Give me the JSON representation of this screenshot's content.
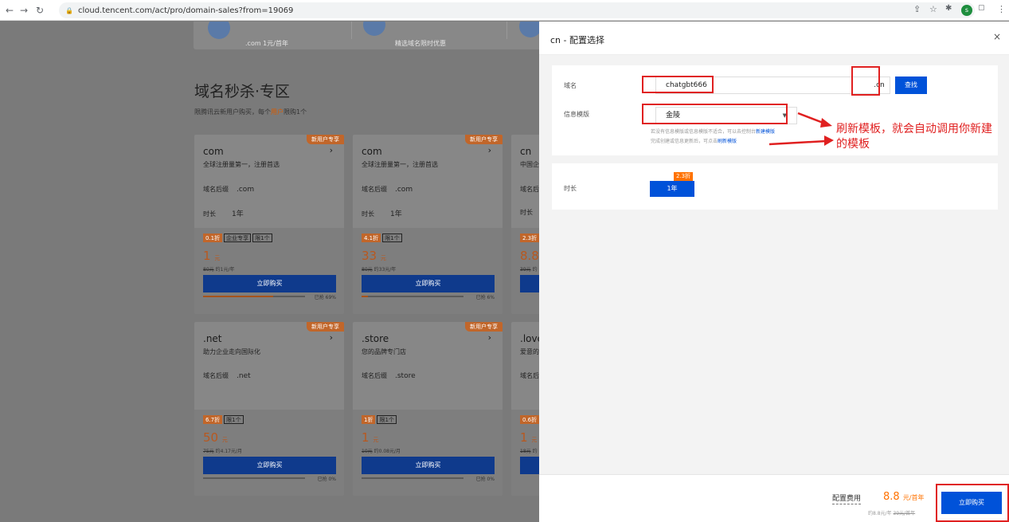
{
  "browser": {
    "url": "cloud.tencent.com/act/pro/domain-sales?from=19069",
    "avatar": "s"
  },
  "top_strip": [
    {
      "sub": ".com 1元/首年"
    },
    {
      "sub": "精选域名限时优惠"
    }
  ],
  "page": {
    "title": "域名秒杀·专区",
    "subtitle_pre": "限腾讯云新用户购买，每个",
    "subtitle_hl": "用户",
    "subtitle_post": "限购1个"
  },
  "cards": [
    {
      "tag": "新用户专享",
      "name": "com",
      "desc": "全球注册量第一，注册首选",
      "suffix_label": "域名后缀",
      "suffix": ".com",
      "dur_label": "时长",
      "dur": "1年",
      "badges": [
        "0.1折",
        "企业专享",
        "限1个"
      ],
      "price": "1",
      "unit": "元",
      "orig": "80元",
      "approx": "约1元/年",
      "buy": "立即购买",
      "sold": "已抢 69%",
      "progress": 0.69
    },
    {
      "tag": "新用户专享",
      "name": "com",
      "desc": "全球注册量第一，注册首选",
      "suffix_label": "域名后缀",
      "suffix": ".com",
      "dur_label": "时长",
      "dur": "1年",
      "badges": [
        "4.1折",
        "限1个"
      ],
      "price": "33",
      "unit": "元",
      "orig": "80元",
      "approx": "约33元/年",
      "buy": "立即购买",
      "sold": "已抢 6%",
      "progress": 0.06
    },
    {
      "name": "cn",
      "desc": "中国企",
      "suffix_label": "域名后",
      "dur_label": "时长",
      "badges": [
        "2.3折"
      ],
      "price": "8.8",
      "orig": "39元",
      "approx": "约",
      "buy": "立"
    },
    {
      "tag": "新用户专享",
      "name": ".net",
      "desc": "助力企业走向国际化",
      "suffix_label": "域名后缀",
      "suffix": ".net",
      "badges": [
        "6.7折",
        "限1个"
      ],
      "price": "50",
      "unit": "元",
      "orig": "75元",
      "approx": "约4.17元/月",
      "buy": "立即购买",
      "sold": "已抢 0%",
      "progress": 0
    },
    {
      "tag": "新用户专享",
      "name": ".store",
      "desc": "您的品牌专门店",
      "suffix_label": "域名后缀",
      "suffix": ".store",
      "badges": [
        "1折",
        "限1个"
      ],
      "price": "1",
      "unit": "元",
      "orig": "10元",
      "approx": "约0.08元/月",
      "buy": "立即购买",
      "sold": "已抢 0%",
      "progress": 0
    },
    {
      "name": ".love",
      "desc": "爱意的",
      "suffix_label": "域名后",
      "badges": [
        "0.6折"
      ],
      "price": "1",
      "unit": "元",
      "orig": "18元",
      "approx": "约",
      "buy": "立"
    }
  ],
  "panel": {
    "title": "cn - 配置选择",
    "close": "×",
    "domain_label": "域名",
    "domain_value": "chatgbt666",
    "domain_suffix": ".cn",
    "search_btn": "查找",
    "template_label": "信息模版",
    "template_value": "金陵",
    "hint1_pre": "若没有信息模版或信息模版不适合，可以去控制台",
    "hint1_link": "新建模版",
    "hint2_pre": "完成创建或信息更新后，可点击",
    "hint2_link": "刷新模版",
    "duration_label": "时长",
    "duration_value": "1年",
    "duration_tag": "2.3折",
    "fee_label": "配置费用",
    "fee_price": "8.8",
    "fee_unit": "元/首年",
    "fee_orig_pre": "约8.8元/年",
    "fee_orig_strike": "39元/首年",
    "buy_btn": "立即购买"
  },
  "annotation": {
    "line1": "刷新模板，就会自动调用你新建",
    "line2": "的模板"
  },
  "colors": {
    "accent": "#0052d9",
    "orange": "#ff7200",
    "annotation_red": "#e02020"
  }
}
